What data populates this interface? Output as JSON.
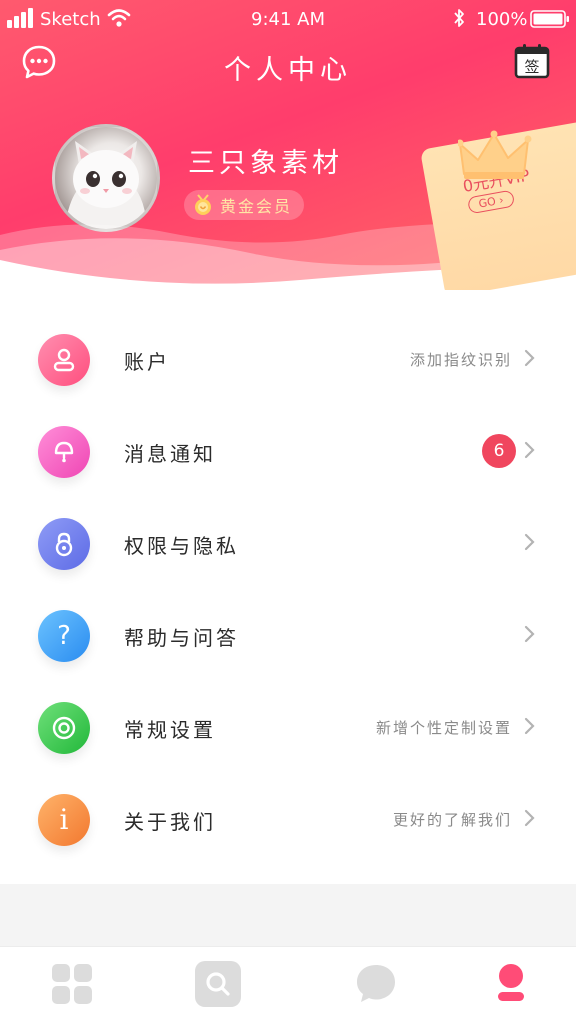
{
  "status_bar": {
    "carrier": "Sketch",
    "time": "9:41 AM",
    "battery": "100%"
  },
  "header": {
    "title": "个人中心",
    "checkin_label": "签",
    "user_name": "三只象素材",
    "member_level": "黄金会员",
    "vip_promo": "0元升VIP",
    "vip_go": "GO ›"
  },
  "colors": {
    "header_gradient": [
      "#ff5a6e",
      "#ff3d6c",
      "#ff6a63"
    ],
    "vip_card": "#ffe0ae",
    "badge": "#f0465e"
  },
  "menu": [
    {
      "icon": "user-icon",
      "label": "账户",
      "hint": "添加指纹识别"
    },
    {
      "icon": "notification-icon",
      "label": "消息通知",
      "badge": "6"
    },
    {
      "icon": "lock-icon",
      "label": "权限与隐私"
    },
    {
      "icon": "help-icon",
      "label": "帮助与问答",
      "icon_text": "?"
    },
    {
      "icon": "settings-icon",
      "label": "常规设置",
      "hint": "新增个性定制设置"
    },
    {
      "icon": "info-icon",
      "label": "关于我们",
      "hint": "更好的了解我们",
      "icon_text": "i"
    }
  ],
  "tabbar": [
    {
      "icon": "grid-icon",
      "active": false
    },
    {
      "icon": "search-icon",
      "active": false
    },
    {
      "icon": "chat-icon",
      "active": false
    },
    {
      "icon": "profile-icon",
      "active": true
    }
  ]
}
